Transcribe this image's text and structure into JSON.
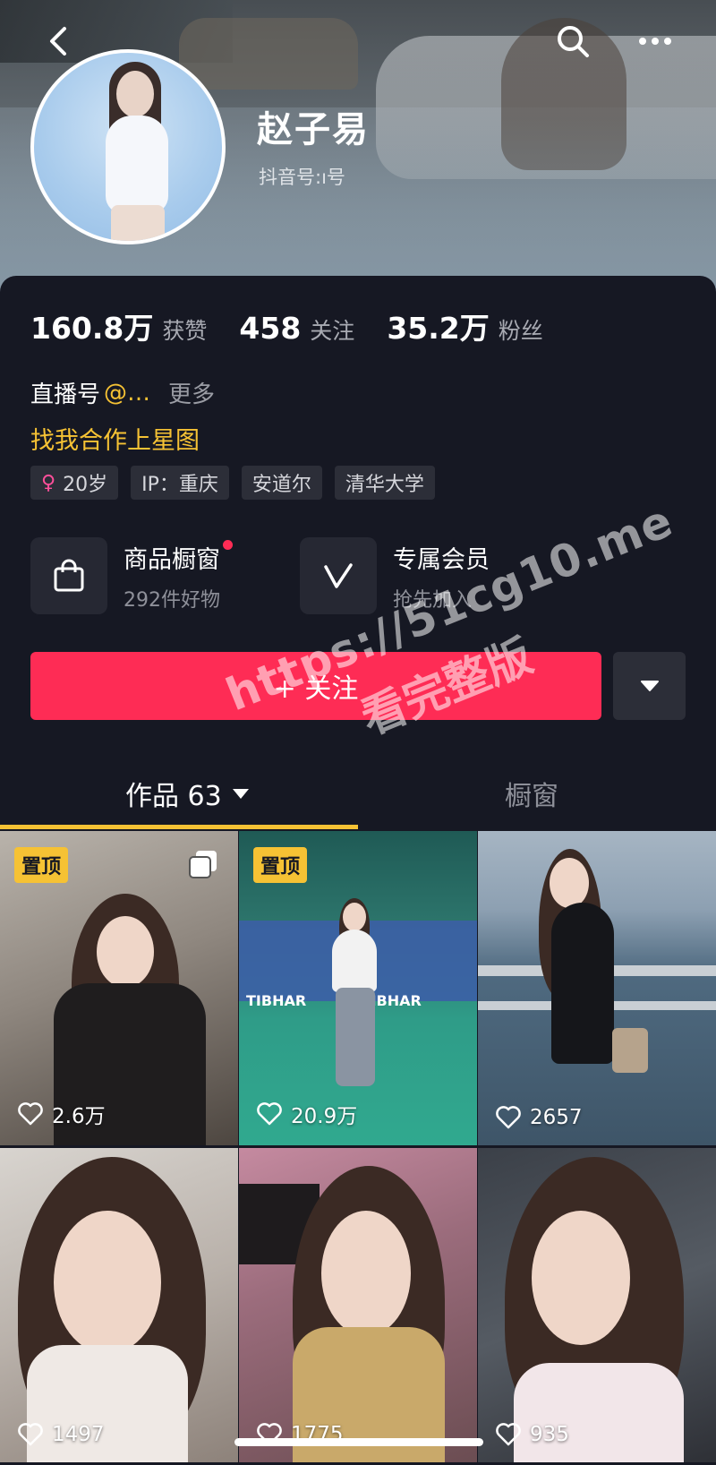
{
  "profile": {
    "name": "赵子易",
    "douyin_id": "抖音号:ı号"
  },
  "stats": [
    {
      "value": "160.8万",
      "label": "获赞"
    },
    {
      "value": "458",
      "label": "关注"
    },
    {
      "value": "35.2万",
      "label": "粉丝"
    }
  ],
  "bio": {
    "live_prefix": "直播号",
    "live_handle": "@…",
    "more": "更多",
    "slogan": "找我合作上星图"
  },
  "tags": [
    {
      "icon": "female-icon",
      "text": "20岁"
    },
    {
      "text": "IP：重庆"
    },
    {
      "text": "安道尔"
    },
    {
      "text": "清华大学"
    }
  ],
  "features": {
    "shop": {
      "title": "商品橱窗",
      "subtitle": "292件好物",
      "icon": "shopping-bag-icon"
    },
    "member": {
      "title": "专属会员",
      "subtitle": "抢先加入",
      "icon": "vip-v-icon"
    }
  },
  "actions": {
    "follow_label": "+ 关注",
    "dropdown_icon": "triangle-down-icon"
  },
  "watermark": {
    "line1": "https://51cg10.me",
    "line2": "看完整版"
  },
  "tabs": [
    {
      "label": "作品 63",
      "active": true
    },
    {
      "label": "橱窗",
      "active": false
    }
  ],
  "videos": [
    {
      "pinned": "置顶",
      "likes": "2.6万",
      "multi": true
    },
    {
      "pinned": "置顶",
      "likes": "20.9万",
      "multi": false
    },
    {
      "likes": "2657"
    },
    {
      "likes": "1497"
    },
    {
      "likes": "1775"
    },
    {
      "likes": "935"
    }
  ],
  "colors": {
    "accent_red": "#fe2c55",
    "accent_yellow": "#f6c234",
    "background": "#161823"
  }
}
